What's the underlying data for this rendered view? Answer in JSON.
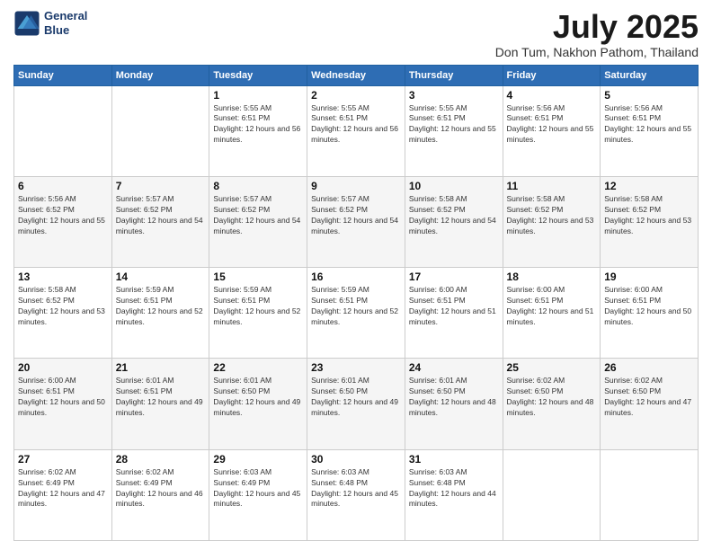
{
  "logo": {
    "line1": "General",
    "line2": "Blue"
  },
  "header": {
    "month": "July 2025",
    "location": "Don Tum, Nakhon Pathom, Thailand"
  },
  "weekdays": [
    "Sunday",
    "Monday",
    "Tuesday",
    "Wednesday",
    "Thursday",
    "Friday",
    "Saturday"
  ],
  "weeks": [
    [
      {
        "day": "",
        "info": ""
      },
      {
        "day": "",
        "info": ""
      },
      {
        "day": "1",
        "info": "Sunrise: 5:55 AM\nSunset: 6:51 PM\nDaylight: 12 hours and 56 minutes."
      },
      {
        "day": "2",
        "info": "Sunrise: 5:55 AM\nSunset: 6:51 PM\nDaylight: 12 hours and 56 minutes."
      },
      {
        "day": "3",
        "info": "Sunrise: 5:55 AM\nSunset: 6:51 PM\nDaylight: 12 hours and 55 minutes."
      },
      {
        "day": "4",
        "info": "Sunrise: 5:56 AM\nSunset: 6:51 PM\nDaylight: 12 hours and 55 minutes."
      },
      {
        "day": "5",
        "info": "Sunrise: 5:56 AM\nSunset: 6:51 PM\nDaylight: 12 hours and 55 minutes."
      }
    ],
    [
      {
        "day": "6",
        "info": "Sunrise: 5:56 AM\nSunset: 6:52 PM\nDaylight: 12 hours and 55 minutes."
      },
      {
        "day": "7",
        "info": "Sunrise: 5:57 AM\nSunset: 6:52 PM\nDaylight: 12 hours and 54 minutes."
      },
      {
        "day": "8",
        "info": "Sunrise: 5:57 AM\nSunset: 6:52 PM\nDaylight: 12 hours and 54 minutes."
      },
      {
        "day": "9",
        "info": "Sunrise: 5:57 AM\nSunset: 6:52 PM\nDaylight: 12 hours and 54 minutes."
      },
      {
        "day": "10",
        "info": "Sunrise: 5:58 AM\nSunset: 6:52 PM\nDaylight: 12 hours and 54 minutes."
      },
      {
        "day": "11",
        "info": "Sunrise: 5:58 AM\nSunset: 6:52 PM\nDaylight: 12 hours and 53 minutes."
      },
      {
        "day": "12",
        "info": "Sunrise: 5:58 AM\nSunset: 6:52 PM\nDaylight: 12 hours and 53 minutes."
      }
    ],
    [
      {
        "day": "13",
        "info": "Sunrise: 5:58 AM\nSunset: 6:52 PM\nDaylight: 12 hours and 53 minutes."
      },
      {
        "day": "14",
        "info": "Sunrise: 5:59 AM\nSunset: 6:51 PM\nDaylight: 12 hours and 52 minutes."
      },
      {
        "day": "15",
        "info": "Sunrise: 5:59 AM\nSunset: 6:51 PM\nDaylight: 12 hours and 52 minutes."
      },
      {
        "day": "16",
        "info": "Sunrise: 5:59 AM\nSunset: 6:51 PM\nDaylight: 12 hours and 52 minutes."
      },
      {
        "day": "17",
        "info": "Sunrise: 6:00 AM\nSunset: 6:51 PM\nDaylight: 12 hours and 51 minutes."
      },
      {
        "day": "18",
        "info": "Sunrise: 6:00 AM\nSunset: 6:51 PM\nDaylight: 12 hours and 51 minutes."
      },
      {
        "day": "19",
        "info": "Sunrise: 6:00 AM\nSunset: 6:51 PM\nDaylight: 12 hours and 50 minutes."
      }
    ],
    [
      {
        "day": "20",
        "info": "Sunrise: 6:00 AM\nSunset: 6:51 PM\nDaylight: 12 hours and 50 minutes."
      },
      {
        "day": "21",
        "info": "Sunrise: 6:01 AM\nSunset: 6:51 PM\nDaylight: 12 hours and 49 minutes."
      },
      {
        "day": "22",
        "info": "Sunrise: 6:01 AM\nSunset: 6:50 PM\nDaylight: 12 hours and 49 minutes."
      },
      {
        "day": "23",
        "info": "Sunrise: 6:01 AM\nSunset: 6:50 PM\nDaylight: 12 hours and 49 minutes."
      },
      {
        "day": "24",
        "info": "Sunrise: 6:01 AM\nSunset: 6:50 PM\nDaylight: 12 hours and 48 minutes."
      },
      {
        "day": "25",
        "info": "Sunrise: 6:02 AM\nSunset: 6:50 PM\nDaylight: 12 hours and 48 minutes."
      },
      {
        "day": "26",
        "info": "Sunrise: 6:02 AM\nSunset: 6:50 PM\nDaylight: 12 hours and 47 minutes."
      }
    ],
    [
      {
        "day": "27",
        "info": "Sunrise: 6:02 AM\nSunset: 6:49 PM\nDaylight: 12 hours and 47 minutes."
      },
      {
        "day": "28",
        "info": "Sunrise: 6:02 AM\nSunset: 6:49 PM\nDaylight: 12 hours and 46 minutes."
      },
      {
        "day": "29",
        "info": "Sunrise: 6:03 AM\nSunset: 6:49 PM\nDaylight: 12 hours and 45 minutes."
      },
      {
        "day": "30",
        "info": "Sunrise: 6:03 AM\nSunset: 6:48 PM\nDaylight: 12 hours and 45 minutes."
      },
      {
        "day": "31",
        "info": "Sunrise: 6:03 AM\nSunset: 6:48 PM\nDaylight: 12 hours and 44 minutes."
      },
      {
        "day": "",
        "info": ""
      },
      {
        "day": "",
        "info": ""
      }
    ]
  ]
}
